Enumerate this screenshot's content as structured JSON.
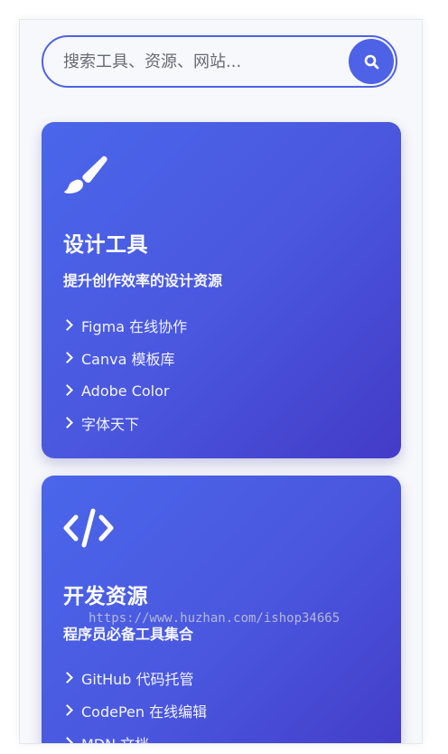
{
  "search": {
    "placeholder": "搜索工具、资源、网站..."
  },
  "cards": [
    {
      "icon": "paintbrush-icon",
      "title": "设计工具",
      "description": "提升创作效率的设计资源",
      "links": [
        "Figma 在线协作",
        "Canva 模板库",
        "Adobe Color",
        "字体天下"
      ]
    },
    {
      "icon": "code-icon",
      "title": "开发资源",
      "description": "程序员必备工具集合",
      "links": [
        "GitHub 代码托管",
        "CodePen 在线编辑",
        "MDN 文档"
      ]
    }
  ],
  "watermark": "https://www.huzhan.com/ishop34665",
  "colors": {
    "accent": "#4d62e6",
    "card_gradient_start": "#4a66ea",
    "card_gradient_end": "#433bc8"
  }
}
